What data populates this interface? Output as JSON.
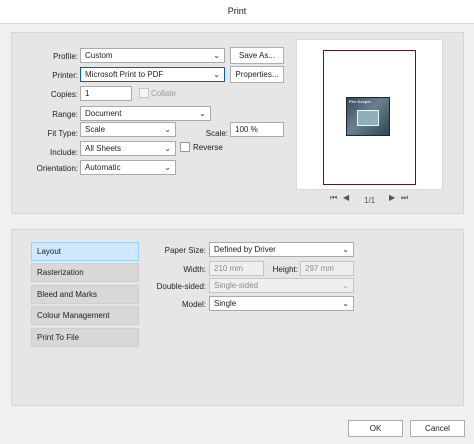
{
  "window": {
    "title": "Print"
  },
  "general": {
    "profile_label": "Profile:",
    "profile_value": "Custom",
    "save_as_label": "Save As...",
    "printer_label": "Printer:",
    "printer_value": "Microsoft Print to PDF",
    "properties_label": "Properties...",
    "copies_label": "Copies:",
    "copies_value": "1",
    "collate_label": "Collate",
    "range_label": "Range:",
    "range_value": "Document",
    "fit_type_label": "Fit Type:",
    "fit_type_value": "Scale",
    "scale_label": "Scale:",
    "scale_value": "100 %",
    "include_label": "Include:",
    "include_value": "All Sheets",
    "reverse_label": "Reverse",
    "orientation_label": "Orientation:",
    "orientation_value": "Automatic"
  },
  "preview": {
    "thumb_caption": "Fire Keeper",
    "page_indicator": "1/1"
  },
  "sidebar": {
    "items": [
      {
        "label": "Layout"
      },
      {
        "label": "Rasterization"
      },
      {
        "label": "Bleed and Marks"
      },
      {
        "label": "Colour Management"
      },
      {
        "label": "Print To File"
      }
    ]
  },
  "layout": {
    "paper_size_label": "Paper Size:",
    "paper_size_value": "Defined by Driver",
    "width_label": "Width:",
    "width_value": "210 mm",
    "height_label": "Height:",
    "height_value": "297 mm",
    "double_sided_label": "Double-sided:",
    "double_sided_value": "Single-sided",
    "model_label": "Model:",
    "model_value": "Single"
  },
  "footer": {
    "ok_label": "OK",
    "cancel_label": "Cancel"
  },
  "icons": {
    "dropdown": "chevron-down-icon",
    "first": "first-page-icon",
    "prev": "previous-page-icon",
    "next": "next-page-icon",
    "last": "last-page-icon"
  }
}
